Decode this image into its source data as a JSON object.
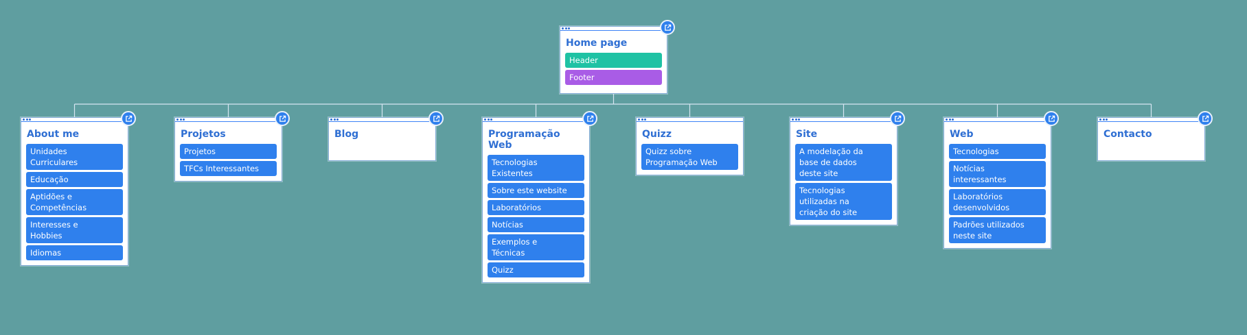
{
  "root": {
    "title": "Home page",
    "items": [
      {
        "label": "Header",
        "color": "#1fc2a4"
      },
      {
        "label": "Footer",
        "color": "#a95ce6"
      }
    ]
  },
  "children": [
    {
      "title": "About me",
      "items": [
        "Unidades\nCurriculares",
        "Educação",
        "Aptidões e\nCompetências",
        "Interesses e\nHobbies",
        "Idiomas"
      ]
    },
    {
      "title": "Projetos",
      "items": [
        "Projetos",
        "TFCs Interessantes"
      ]
    },
    {
      "title": "Blog",
      "items": []
    },
    {
      "title": "Programação\nWeb",
      "items": [
        "Tecnologias\nExistentes",
        "Sobre este website",
        "Laboratórios",
        "Notícias",
        "Exemplos e\nTécnicas",
        "Quizz"
      ]
    },
    {
      "title": "Quizz",
      "items": [
        "Quizz sobre\nProgramação Web"
      ]
    },
    {
      "title": "Site",
      "items": [
        "A modelação da\nbase de dados\ndeste site",
        "Tecnologias\nutilizadas na\ncriação do site"
      ]
    },
    {
      "title": "Web",
      "items": [
        "Tecnologias",
        "Notícias\ninteressantes",
        "Laboratórios\ndesenvolvidos",
        "Padrões utilizados\nneste site"
      ]
    },
    {
      "title": "Contacto",
      "items": []
    }
  ],
  "colors": {
    "background": "#5f9ea0",
    "item": "#2f80ed",
    "title": "#2f6fd3",
    "connector": "#d8e6f2"
  }
}
